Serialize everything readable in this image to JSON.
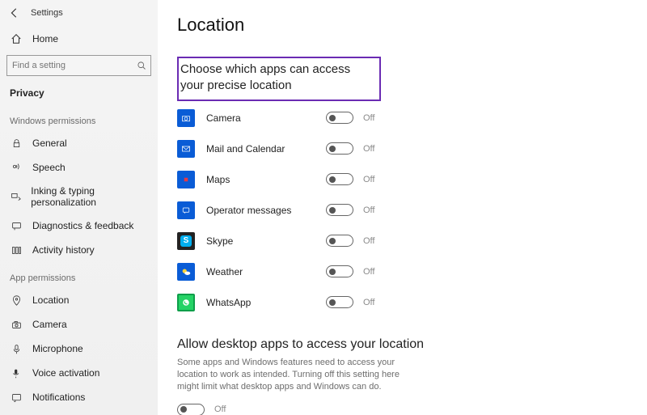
{
  "header": {
    "app_title": "Settings"
  },
  "home_label": "Home",
  "search": {
    "placeholder": "Find a setting"
  },
  "category_label": "Privacy",
  "group_windows_label": "Windows permissions",
  "group_app_label": "App permissions",
  "nav_windows": {
    "general": "General",
    "speech": "Speech",
    "inking": "Inking & typing personalization",
    "diagnostics": "Diagnostics & feedback",
    "activity": "Activity history"
  },
  "nav_app": {
    "location": "Location",
    "camera": "Camera",
    "microphone": "Microphone",
    "voice": "Voice activation",
    "notifications": "Notifications"
  },
  "page_title": "Location",
  "section_precise_title": "Choose which apps can access your precise location",
  "toggle_off_label": "Off",
  "apps": {
    "camera": "Camera",
    "mail": "Mail and Calendar",
    "maps": "Maps",
    "operator": "Operator messages",
    "skype": "Skype",
    "weather": "Weather",
    "whatsapp": "WhatsApp"
  },
  "section_desktop": {
    "title": "Allow desktop apps to access your location",
    "desc": "Some apps and Windows features need to access your location to work as intended. Turning off this setting here might limit what desktop apps and Windows can do."
  }
}
